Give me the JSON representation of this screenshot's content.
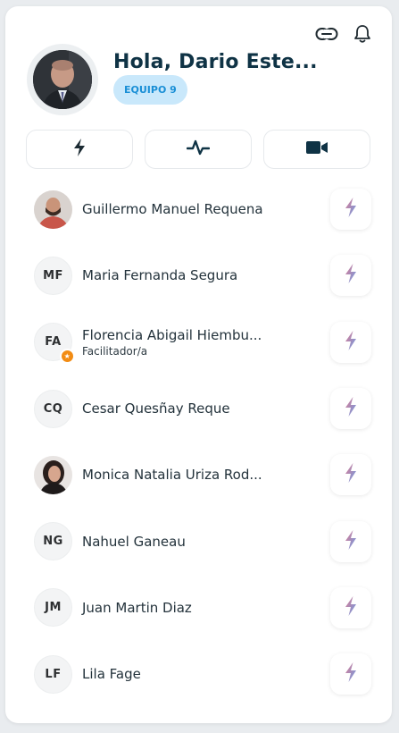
{
  "header": {
    "greeting": "Hola, Dario Este...",
    "team_badge": "EQUIPO 9"
  },
  "top_icons": [
    "link-icon",
    "bell-icon"
  ],
  "actions": [
    {
      "icon": "lightning-icon"
    },
    {
      "icon": "pulse-icon"
    },
    {
      "icon": "video-camera-icon"
    }
  ],
  "colors": {
    "title": "#0f3345",
    "badge_bg": "#c9e8fb",
    "badge_text": "#1a8fd6",
    "medal": "#f28c14",
    "zap_gradient_start": "#e07b8f",
    "zap_gradient_end": "#6a9ee8"
  },
  "members": [
    {
      "initials": "",
      "name": "Guillermo Manuel Requena",
      "role": "",
      "photo": true
    },
    {
      "initials": "MF",
      "name": "Maria Fernanda Segura",
      "role": "",
      "photo": false
    },
    {
      "initials": "FA",
      "name": "Florencia Abigail Hiembu...",
      "role": "Facilitador/a",
      "photo": false
    },
    {
      "initials": "CQ",
      "name": "Cesar Quesñay Reque",
      "role": "",
      "photo": false
    },
    {
      "initials": "",
      "name": "Monica Natalia Uriza Rod...",
      "role": "",
      "photo": true
    },
    {
      "initials": "NG",
      "name": "Nahuel Ganeau",
      "role": "",
      "photo": false
    },
    {
      "initials": "JM",
      "name": "Juan Martin Diaz",
      "role": "",
      "photo": false
    },
    {
      "initials": "LF",
      "name": "Lila Fage",
      "role": "",
      "photo": false
    }
  ]
}
